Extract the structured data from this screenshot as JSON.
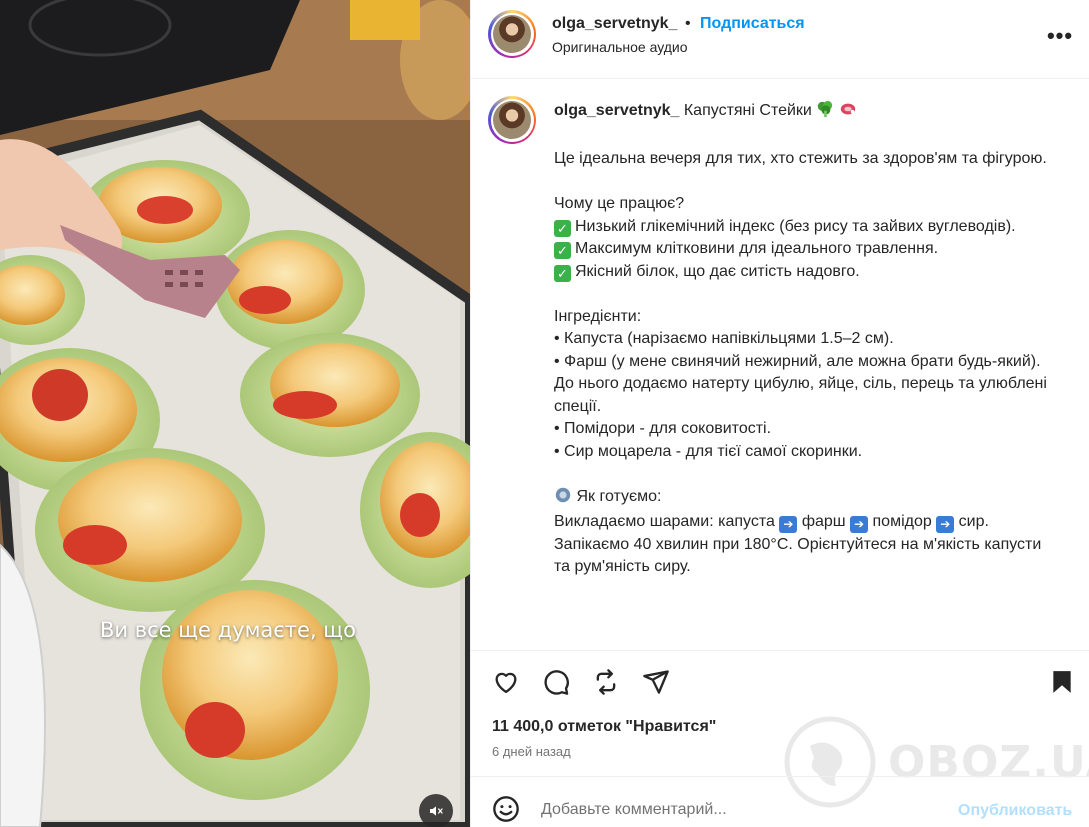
{
  "media": {
    "overlay_caption": "Ви все ще думаєте, що",
    "mute_icon": "speaker-muted-icon"
  },
  "header": {
    "username": "olga_servetnyk_",
    "separator": "•",
    "follow_label": "Подписаться",
    "audio_label": "Оригинальное аудио",
    "more_icon": "more-horizontal-icon",
    "more_label": "•••"
  },
  "caption": {
    "username": "olga_servetnyk_",
    "title": "Капустяні Стейки",
    "title_emojis": [
      "broccoli-icon",
      "meat-icon"
    ],
    "intro": "Це ідеальна вечеря для тих, хто стежить за здоров'ям та фігурою.",
    "why_heading": "Чому це працює?",
    "why_items": [
      "Низький глікемічний індекс (без рису та зайвих вуглеводів).",
      "Максимум клітковини для ідеального травлення.",
      "Якісний білок, що дає ситість надовго."
    ],
    "ingredients_heading": "Інгредієнти:",
    "ingredients": [
      "• Капуста (нарізаємо напівкільцями 1.5–2 см).",
      "• Фарш (у мене свинячий нежирний, але можна брати будь-який). До нього додаємо натерту цибулю, яйце, сіль, перець та улюблені спеції.",
      "• Помідори - для соковитості.",
      "• Сир моцарела - для тієї самої скоринки."
    ],
    "how_heading": "Як готуємо:",
    "steps_prefix": "Викладаємо шарами: капуста",
    "steps_items": [
      "фарш",
      "помідор",
      "сир."
    ],
    "bake_text": "Запікаємо 40 хвилин при 180°C. Орієнтуйтеся на м'якість капусти та рум'яність сиру."
  },
  "actions": {
    "icons": [
      "heart-icon",
      "comment-icon",
      "repost-icon",
      "share-icon",
      "bookmark-icon"
    ]
  },
  "stats": {
    "likes": "11 400,0 отметок \"Нравится\"",
    "posted": "6 дней назад"
  },
  "comment": {
    "placeholder": "Добавьте комментарий...",
    "publish_label": "Опубликовать"
  },
  "watermark": {
    "text": "OBOZ.UA"
  },
  "colors": {
    "accent": "#0095f6",
    "publish_disabled": "#b2dffc",
    "check_green": "#3bb14a",
    "arrow_blue": "#3a7bd5"
  }
}
